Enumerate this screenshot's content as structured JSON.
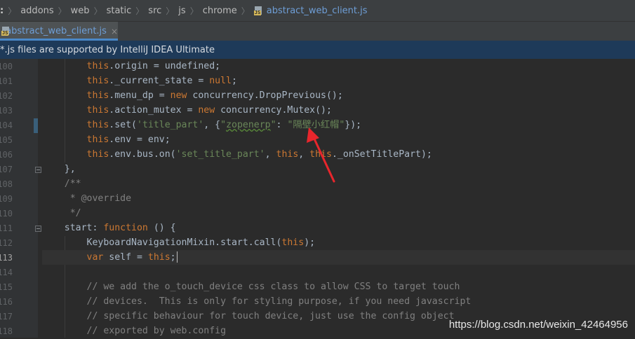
{
  "breadcrumb": {
    "items": [
      ":",
      "addons",
      "web",
      "static",
      "src",
      "js",
      "chrome"
    ],
    "file": "abstract_web_client.js",
    "file_icon": "js-file-icon"
  },
  "tab": {
    "label": "abstract_web_client.js",
    "close": "×",
    "icon": "js-file-icon",
    "accent": "#4a88c7"
  },
  "banner": {
    "text": "*.js files are supported by IntelliJ IDEA Ultimate",
    "bg": "#1e3a59"
  },
  "gutter": {
    "lines": [
      "100",
      "101",
      "102",
      "103",
      "104",
      "105",
      "106",
      "107",
      "108",
      "109",
      "110",
      "111",
      "112",
      "113",
      "114",
      "115",
      "116",
      "117",
      "118"
    ]
  },
  "code": {
    "l100": {
      "this": "this",
      "rest": ".origin = undefined;"
    },
    "l101": {
      "this": "this",
      "mid": "._current_state = ",
      "kw": "null",
      "end": ";"
    },
    "l102": {
      "this": "this",
      "mid": ".menu_dp = ",
      "kw": "new",
      "end": " concurrency.DropPrevious();"
    },
    "l103": {
      "this": "this",
      "mid": ".action_mutex = ",
      "kw": "new",
      "end": " concurrency.Mutex();"
    },
    "l104": {
      "this": "this",
      "a": ".set(",
      "s1": "'title_part'",
      "b": ", {",
      "s2q": "\"",
      "s2w": "zopenerp",
      "s2e": "\"",
      "c": ": ",
      "s3": "\"隔壁小红帽\"",
      "d": "});"
    },
    "l105": {
      "this": "this",
      "a": ".env = env;"
    },
    "l106": {
      "this": "this",
      "a": ".env.bus.on(",
      "s1": "'set_title_part'",
      "b": ", ",
      "this2": "this",
      "c": ", ",
      "this3": "this",
      "d": "._onSetTitlePart);"
    },
    "l107": "},",
    "l108": "/**",
    "l109": " * @override",
    "l110": " */",
    "l111": {
      "a": "start: ",
      "kw": "function",
      "b": " () {"
    },
    "l112": {
      "a": "KeyboardNavigationMixin.start.call(",
      "this": "this",
      "b": ");"
    },
    "l113": {
      "kw": "var",
      "a": " self = ",
      "this": "this",
      "b": ";"
    },
    "l115": "// we add the o_touch_device css class to allow CSS to target touch",
    "l116": "// devices.  This is only for styling purpose, if you need javascript",
    "l117": "// specific behaviour for touch device, just use the config object",
    "l118": "// exported by web.config"
  },
  "watermark": "https://blog.csdn.net/weixin_42464956",
  "colors": {
    "keyword": "#cc7832",
    "string": "#6a8759",
    "comment": "#808080",
    "text": "#a9b7c6",
    "arrow": "#e8262c"
  }
}
